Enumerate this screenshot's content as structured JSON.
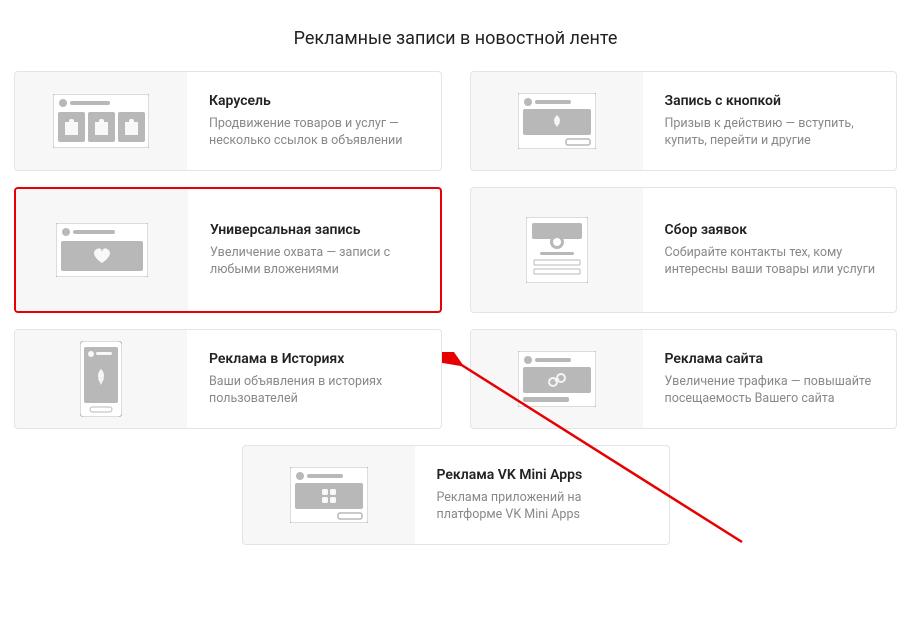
{
  "page_title": "Рекламные записи в новостной ленте",
  "cards": [
    {
      "title": "Карусель",
      "desc": "Продвижение товаров и услуг — несколько ссылок в объявлении"
    },
    {
      "title": "Запись с кнопкой",
      "desc": "Призыв к действию — вступить, купить, перейти и другие"
    },
    {
      "title": "Универсальная запись",
      "desc": "Увеличение охвата — записи с любыми вложениями"
    },
    {
      "title": "Сбор заявок",
      "desc": "Собирайте контакты тех, кому интересны ваши товары или услуги"
    },
    {
      "title": "Реклама в Историях",
      "desc": "Ваши объявления в историях пользователей"
    },
    {
      "title": "Реклама сайта",
      "desc": "Увеличение трафика — повышайте посещаемость Вашего сайта"
    },
    {
      "title": "Реклама VK Mini Apps",
      "desc": "Реклама приложений на платформе VK Mini Apps"
    }
  ]
}
